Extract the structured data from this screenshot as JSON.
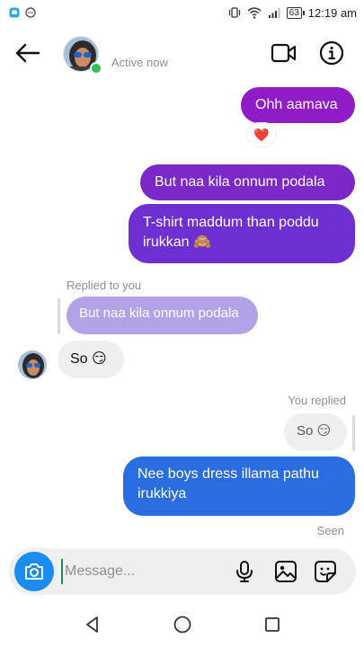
{
  "status_bar": {
    "time": "12:19 am",
    "battery": "63",
    "left_icons": [
      "messenger-app-icon",
      "chat-bubble-icon"
    ],
    "right_icons": [
      "vibrate-icon",
      "wifi-icon",
      "signal-icon",
      "battery-icon"
    ]
  },
  "header": {
    "status": "Active now",
    "icons": [
      "back-arrow-icon",
      "video-call-icon",
      "info-icon"
    ]
  },
  "messages": [
    {
      "type": "sent",
      "text": "Ohh aamava",
      "color": "#8f1cc7",
      "reaction": "❤️"
    },
    {
      "type": "sent",
      "text": "But naa kila onnum podala",
      "color": "#7b28c9"
    },
    {
      "type": "sent",
      "text": "T-shirt maddum than poddu irukkan 🙈",
      "color": "#6d2fd0"
    },
    {
      "type": "received",
      "reply_label": "Replied to you",
      "quoted": "But naa kila onnum podala",
      "text": "So 😏"
    },
    {
      "type": "sent",
      "reply_label": "You replied",
      "quoted": "So 😏",
      "text": "Nee boys dress illama pathu irukkiya",
      "color": "#2a6de0"
    }
  ],
  "seen": "Seen",
  "composer": {
    "placeholder": "Message...",
    "icons": [
      "camera-icon",
      "microphone-icon",
      "gallery-icon",
      "sticker-icon"
    ],
    "camera_color": "#1a8cf0"
  },
  "navbar": {
    "icons": [
      "back-triangle-icon",
      "home-circle-icon",
      "recents-square-icon"
    ]
  }
}
